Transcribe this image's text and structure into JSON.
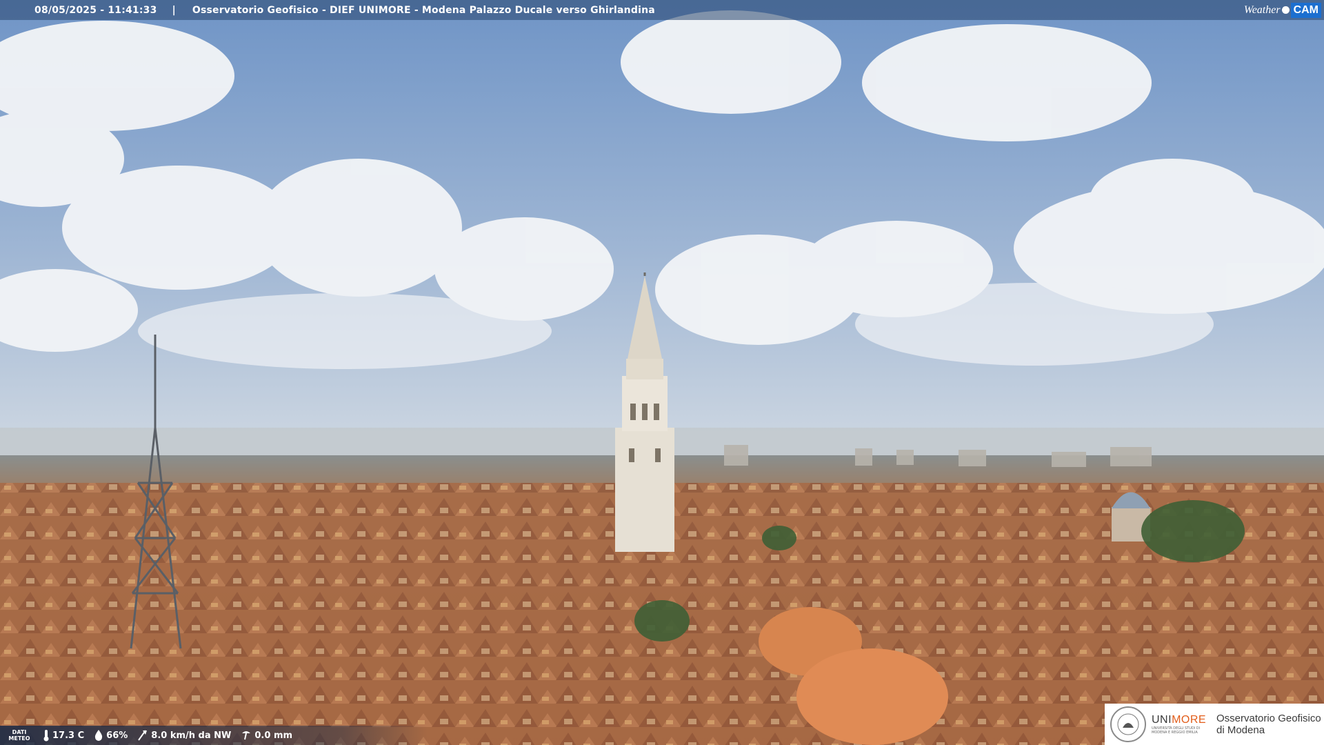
{
  "header": {
    "timestamp": "08/05/2025 - 11:41:33",
    "separator": "|",
    "title": "Osservatorio Geofisico - DIEF UNIMORE - Modena Palazzo Ducale verso Ghirlandina"
  },
  "brand": {
    "weather": "Weather",
    "cam": "CAM"
  },
  "weather_strip": {
    "label_line1": "DATI",
    "label_line2": "METEO",
    "temperature": "17.3 C",
    "humidity": "66%",
    "wind": "8.0 km/h da NW",
    "rain": "0.0 mm",
    "icons": [
      "thermometer-icon",
      "humidity-drop-icon",
      "wind-icon",
      "rain-gauge-icon"
    ]
  },
  "logo": {
    "uni_prefix": "UNI",
    "uni_suffix": "MORE",
    "uni_sub": "UNIVERSITÀ DEGLI STUDI DI MODENA E REGGIO EMILIA",
    "obs_line1": "Osservatorio Geofisico",
    "obs_line2": "di Modena"
  },
  "colors": {
    "sky_top": "#6f94c6",
    "sky_horizon": "#c9d4e0",
    "roof": "#b0714a",
    "tower": "#e8e2d6",
    "unimore_orange": "#e25d1a",
    "weathercam_blue": "#1c6fd0"
  }
}
